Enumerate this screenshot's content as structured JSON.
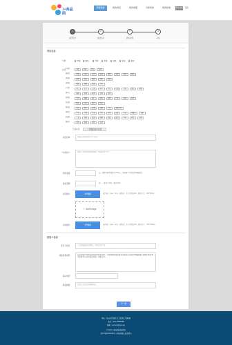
{
  "header": {
    "logo_text": "1+商品网",
    "nav": [
      "项目投放",
      "我的项目",
      "我的收藏",
      "分类导航",
      "我的投放"
    ],
    "login": "登录注册",
    "logout": "退出"
  },
  "steps": [
    "项目信息",
    "投放信息",
    "提交审核",
    "完成"
  ],
  "section1": {
    "title": "项目信息",
    "type_label": "分类:",
    "types": [
      "不限",
      "服饰",
      "生鲜",
      "美妆",
      "母婴",
      "家电",
      "家居"
    ],
    "tags_label": "标签:",
    "tag_rows": [
      {
        "group": "[尺码]",
        "tags": [
          "S码",
          "M码",
          "L码",
          "XL码"
        ]
      },
      {
        "group": "[颜色]",
        "tags": [
          "黑色",
          "白色",
          "红色",
          "蓝色",
          "绿色",
          "灰色",
          "棕色",
          "粉色"
        ]
      },
      {
        "group": "[风格]",
        "tags": [
          "简约",
          "复古",
          "甜美",
          "休闲",
          "运动"
        ]
      },
      {
        "group": "[材质]",
        "tags": [
          "棉质",
          "麻质",
          "丝绸",
          "羊毛"
        ]
      },
      {
        "group": "[人群]",
        "tags": [
          "男士",
          "女士",
          "儿童",
          "老人",
          "学生",
          "白领",
          "宝妈",
          "情侣",
          "家庭"
        ]
      },
      {
        "group": "[季节]",
        "tags": [
          "春季",
          "夏季",
          "秋季",
          "冬季",
          "四季"
        ]
      },
      {
        "group": "[场景]",
        "tags": [
          "日常",
          "通勤",
          "旅行",
          "聚会",
          "居家",
          "户外",
          "运动",
          "商务"
        ]
      },
      {
        "group": "[价格]",
        "tags": [
          "低价",
          "中价",
          "高价",
          "特价"
        ]
      },
      {
        "group": "[渠道]",
        "tags": [
          "线上",
          "线下",
          "直播",
          "社群",
          "门店",
          "电商平台"
        ]
      },
      {
        "group": "[地区]",
        "tags": [
          "华东",
          "华南",
          "华北",
          "华中",
          "西南",
          "西北",
          "东北",
          "港澳台",
          "海外"
        ]
      },
      {
        "group": "[品类]",
        "tags": [
          "上衣",
          "裤装",
          "裙装",
          "鞋靴",
          "配饰",
          "箱包",
          "内衣",
          "家纺",
          "其他"
        ]
      },
      {
        "group": "[服务]",
        "tags": [
          "包邮",
          "退换",
          "质保",
          "定制"
        ]
      }
    ],
    "selected_label": "已选标签:",
    "selected_btn": "+ 添加自定义标签",
    "name_label": "项目名称:",
    "name_placeholder": "请输入项目名称(20字以内)",
    "intro_label": "一句话简介:",
    "intro_placeholder": "请用一句话介绍您的项目，不超过50个字",
    "budget_label": "预算金额:",
    "budget_hint": "元，预算金额不能低于1000元，可编辑下方的投放明细修改",
    "period_label": "投放天数:",
    "period_hint": "天，一般为1-30天，建议30天",
    "cover_label": "项目图片:",
    "upload_btn": "上传图片",
    "upload_hint": "支持jpg、jpeg、png、gif格式，大小不超过2M，建议尺寸：200*200px",
    "add_image": "Add Image",
    "detail_label": "详情图片:",
    "detail_btn": "上传图片",
    "detail_hint": "支持jpg、jpeg、png、gif格式，大小不超过2M，建议尺寸：750*1334px"
  },
  "section2": {
    "title": "投放人信息",
    "contact_label": "联系人姓名:",
    "contact_placeholder": "一句话描述您的项目，不超过50个字",
    "desc_label": "投放要求说明:",
    "desc_text": "在此请填写项目投放的相关要求说明，对所需要的投放渠道或投放方式进行明确描述以便我们更好地为您推荐合适的投放资源，谢谢合作。",
    "phone_label": "联系电话:",
    "phone_value": "",
    "email_label": "联系邮箱:",
    "email_placeholder": "请填写您常用的邮箱地址"
  },
  "next_btn": "下一步",
  "footer": {
    "lines": [
      "地址：杭州市西湖区文三路某某大厦8楼",
      "电话：0571-88888888",
      "邮箱：service@1jia.com",
      "© 2018 1+商品网 版权所有",
      "浙ICP备00000000号 | 网站地图 | 联系我们"
    ]
  }
}
